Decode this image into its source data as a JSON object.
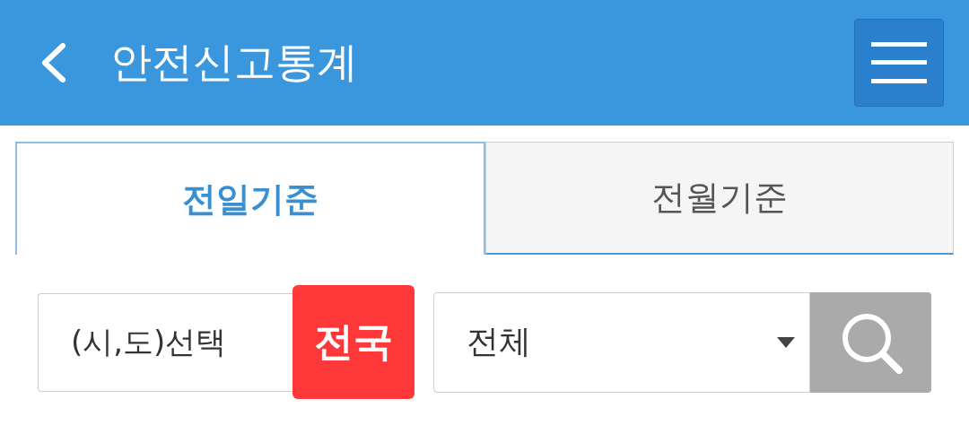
{
  "header": {
    "title": "안전신고통계"
  },
  "tabs": [
    {
      "label": "전일기준",
      "selected": true
    },
    {
      "label": "전월기준",
      "selected": false
    }
  ],
  "filters": {
    "region_label": "(시,도)선택",
    "region_button": "전국",
    "category": "전체"
  }
}
